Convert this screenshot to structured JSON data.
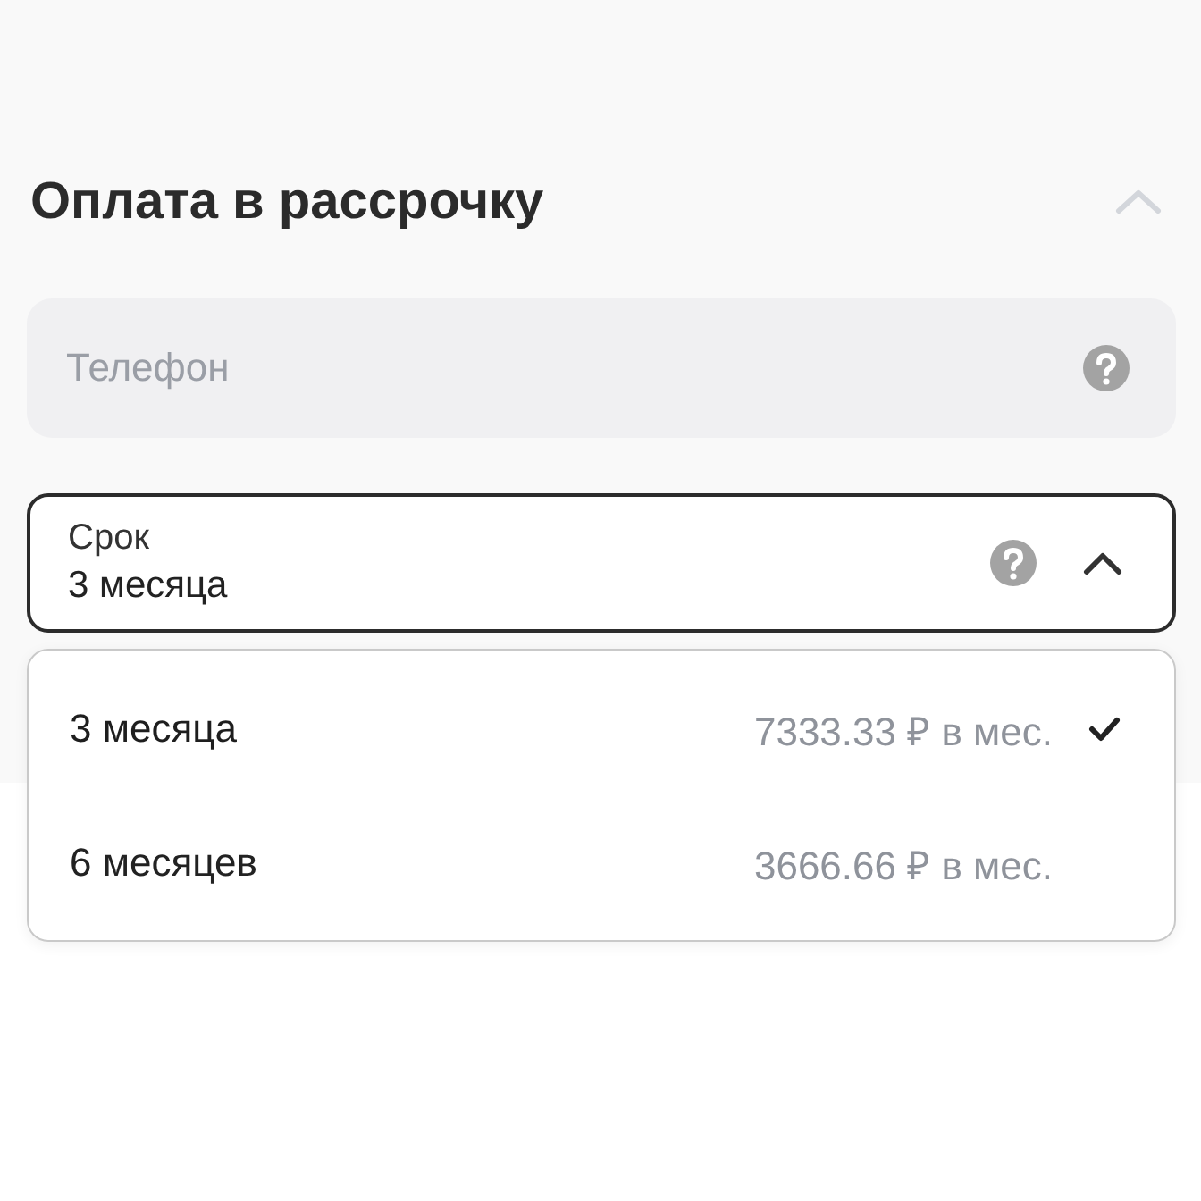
{
  "section": {
    "title": "Оплата в рассрочку",
    "expanded": true
  },
  "phone_field": {
    "placeholder": "Телефон"
  },
  "term_select": {
    "label": "Срок",
    "value": "3 месяца",
    "open": true
  },
  "options": [
    {
      "label": "3 месяца",
      "price": "7333.33 ₽ в мес.",
      "selected": true
    },
    {
      "label": "6 месяцев",
      "price": "3666.66 ₽ в мес.",
      "selected": false
    }
  ]
}
